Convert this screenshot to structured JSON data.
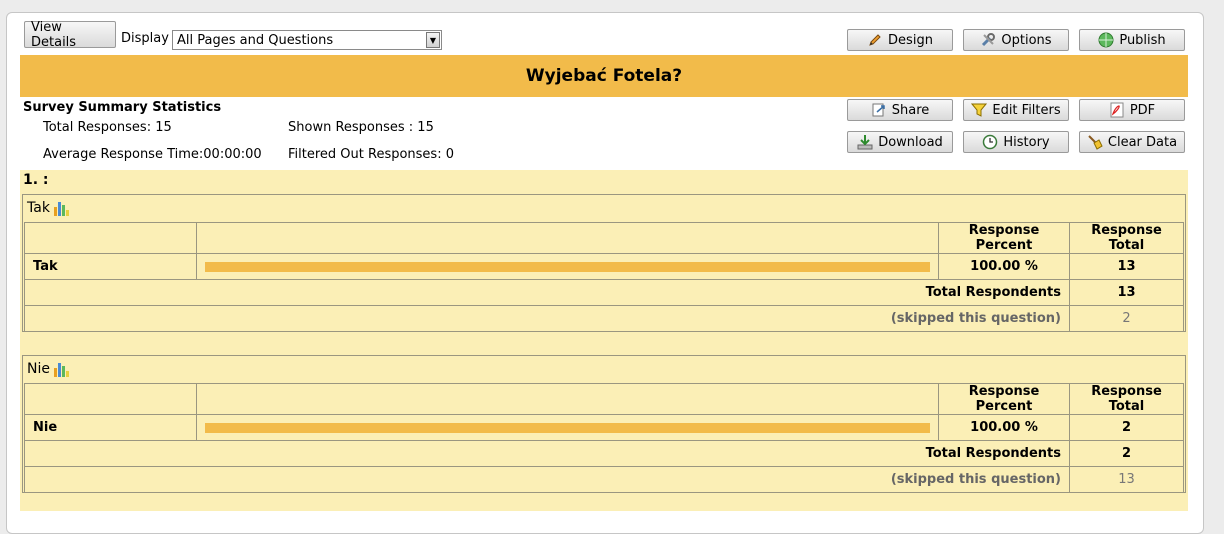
{
  "toolbar": {
    "view_details": "View Details",
    "display_label": "Display",
    "display_value": "All Pages and Questions",
    "design": "Design",
    "options": "Options",
    "publish": "Publish"
  },
  "survey": {
    "title": "Wyjebać Fotela?"
  },
  "stats": {
    "heading": "Survey Summary Statistics",
    "total_responses": "Total Responses: 15",
    "shown_responses": "Shown Responses :  15",
    "avg_time": "Average Response Time:00:00:00",
    "filtered_out": "Filtered Out Responses: 0"
  },
  "actions": {
    "share": "Share",
    "edit_filters": "Edit Filters",
    "pdf": "PDF",
    "download": "Download",
    "history": "History",
    "clear_data": "Clear Data"
  },
  "question": {
    "label": "1. :"
  },
  "blocks": [
    {
      "title": "Tak",
      "col_percent": "Response Percent",
      "col_total": "Response Total",
      "answer": "Tak",
      "percent_text": "100.00 %",
      "percent_value": 1.0,
      "total": "13",
      "respondents_label": "Total Respondents",
      "respondents": "13",
      "skipped_label": "(skipped this question)",
      "skipped": "2"
    },
    {
      "title": "Nie",
      "col_percent": "Response Percent",
      "col_total": "Response Total",
      "answer": "Nie",
      "percent_text": "100.00 %",
      "percent_value": 1.0,
      "total": "2",
      "respondents_label": "Total Respondents",
      "respondents": "2",
      "skipped_label": "(skipped this question)",
      "skipped": "13"
    }
  ],
  "colors": {
    "accent": "#f2bb4a",
    "pane": "#fbefb6"
  }
}
